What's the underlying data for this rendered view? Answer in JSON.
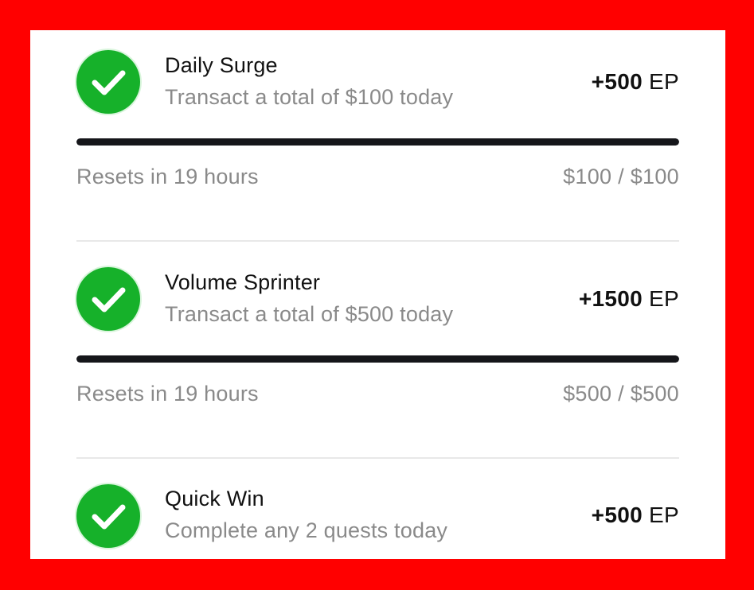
{
  "quests": [
    {
      "title": "Daily Surge",
      "subtitle": "Transact a total of $100 today",
      "reward_amount": "+500",
      "reward_unit": "EP",
      "reset_text": "Resets in 19 hours",
      "progress_text": "$100 / $100",
      "progress_fraction": 1.0,
      "status_icon": "check-circle-icon"
    },
    {
      "title": "Volume Sprinter",
      "subtitle": "Transact a total of $500 today",
      "reward_amount": "+1500",
      "reward_unit": "EP",
      "reset_text": "Resets in 19 hours",
      "progress_text": "$500 / $500",
      "progress_fraction": 1.0,
      "status_icon": "check-circle-icon"
    },
    {
      "title": "Quick Win",
      "subtitle": "Complete any 2 quests today",
      "reward_amount": "+500",
      "reward_unit": "EP",
      "status_icon": "check-circle-icon"
    }
  ],
  "colors": {
    "frame": "#ff0000",
    "card_background": "#ffffff",
    "check_green": "#16b12a",
    "progress_fill": "#15161a",
    "muted_text": "#8a8a8a",
    "primary_text": "#111111"
  }
}
